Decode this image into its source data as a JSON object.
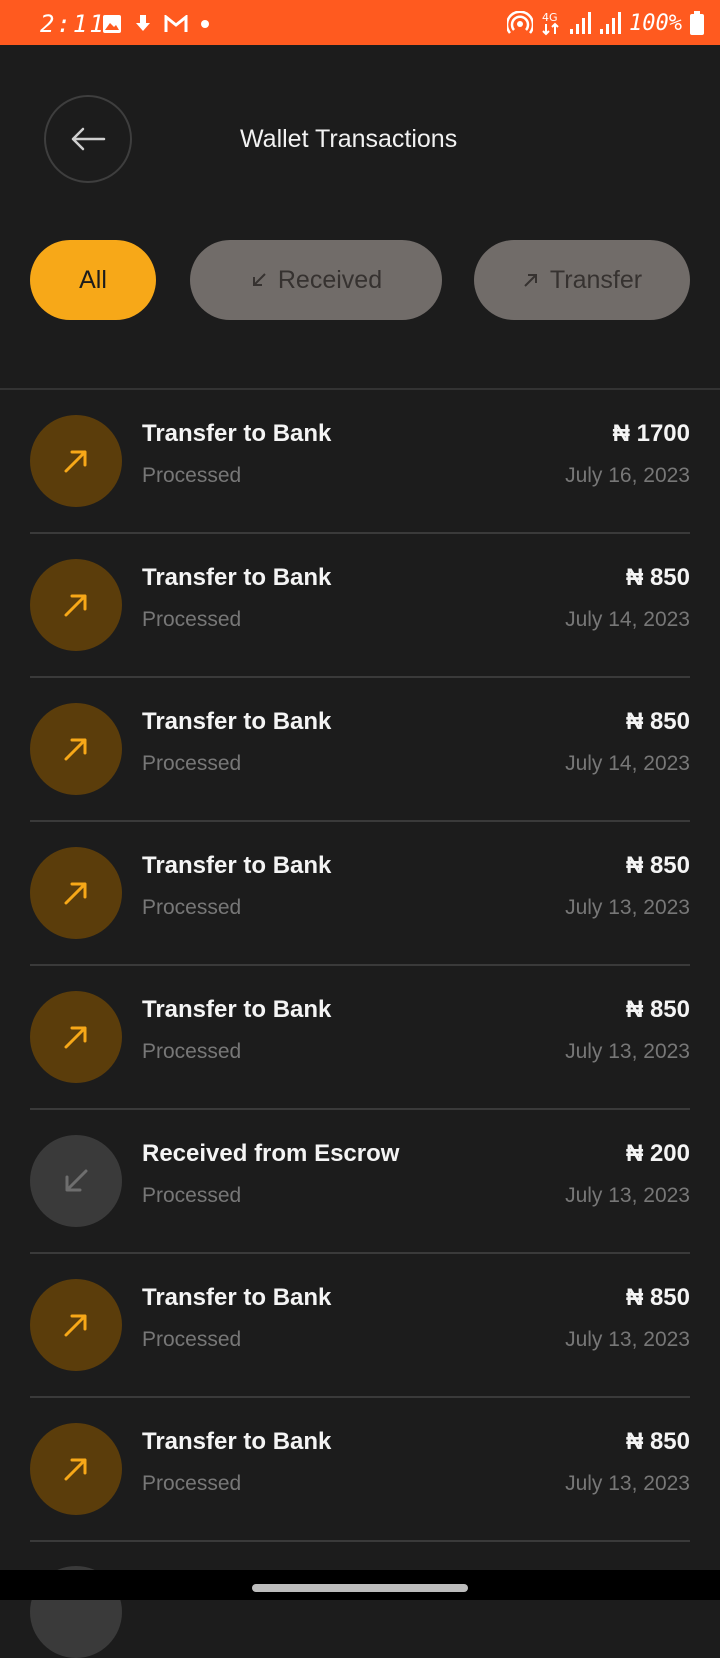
{
  "status_bar": {
    "time": "2:11",
    "battery": "100%",
    "network": "4G",
    "icons_left": [
      "image-icon",
      "download-icon",
      "gmail-icon",
      "dot-icon"
    ],
    "icons_right": [
      "hotspot-icon",
      "4g-icon",
      "signal-icon",
      "signal-icon",
      "battery-icon"
    ]
  },
  "header": {
    "title": "Wallet Transactions",
    "back_icon": "arrow-left-icon"
  },
  "filters": {
    "all": "All",
    "received": "Received",
    "transfer": "Transfer",
    "received_icon": "arrow-down-left-icon",
    "transfer_icon": "arrow-up-right-icon",
    "active": "All"
  },
  "colors": {
    "status_bar": "#ff5a1f",
    "background": "#1c1c1c",
    "accent": "#f7a818",
    "chip_inactive": "#716c69"
  },
  "transactions": [
    {
      "title": "Transfer to Bank",
      "status": "Processed",
      "amount": "₦ 1700",
      "date": "July 16, 2023",
      "direction": "out"
    },
    {
      "title": "Transfer to Bank",
      "status": "Processed",
      "amount": "₦ 850",
      "date": "July 14, 2023",
      "direction": "out"
    },
    {
      "title": "Transfer to Bank",
      "status": "Processed",
      "amount": "₦ 850",
      "date": "July 14, 2023",
      "direction": "out"
    },
    {
      "title": "Transfer to Bank",
      "status": "Processed",
      "amount": "₦ 850",
      "date": "July 13, 2023",
      "direction": "out"
    },
    {
      "title": "Transfer to Bank",
      "status": "Processed",
      "amount": "₦ 850",
      "date": "July 13, 2023",
      "direction": "out"
    },
    {
      "title": "Received from Escrow",
      "status": "Processed",
      "amount": "₦ 200",
      "date": "July 13, 2023",
      "direction": "in"
    },
    {
      "title": "Transfer to Bank",
      "status": "Processed",
      "amount": "₦ 850",
      "date": "July 13, 2023",
      "direction": "out"
    },
    {
      "title": "Transfer to Bank",
      "status": "Processed",
      "amount": "₦ 850",
      "date": "July 13, 2023",
      "direction": "out"
    }
  ]
}
